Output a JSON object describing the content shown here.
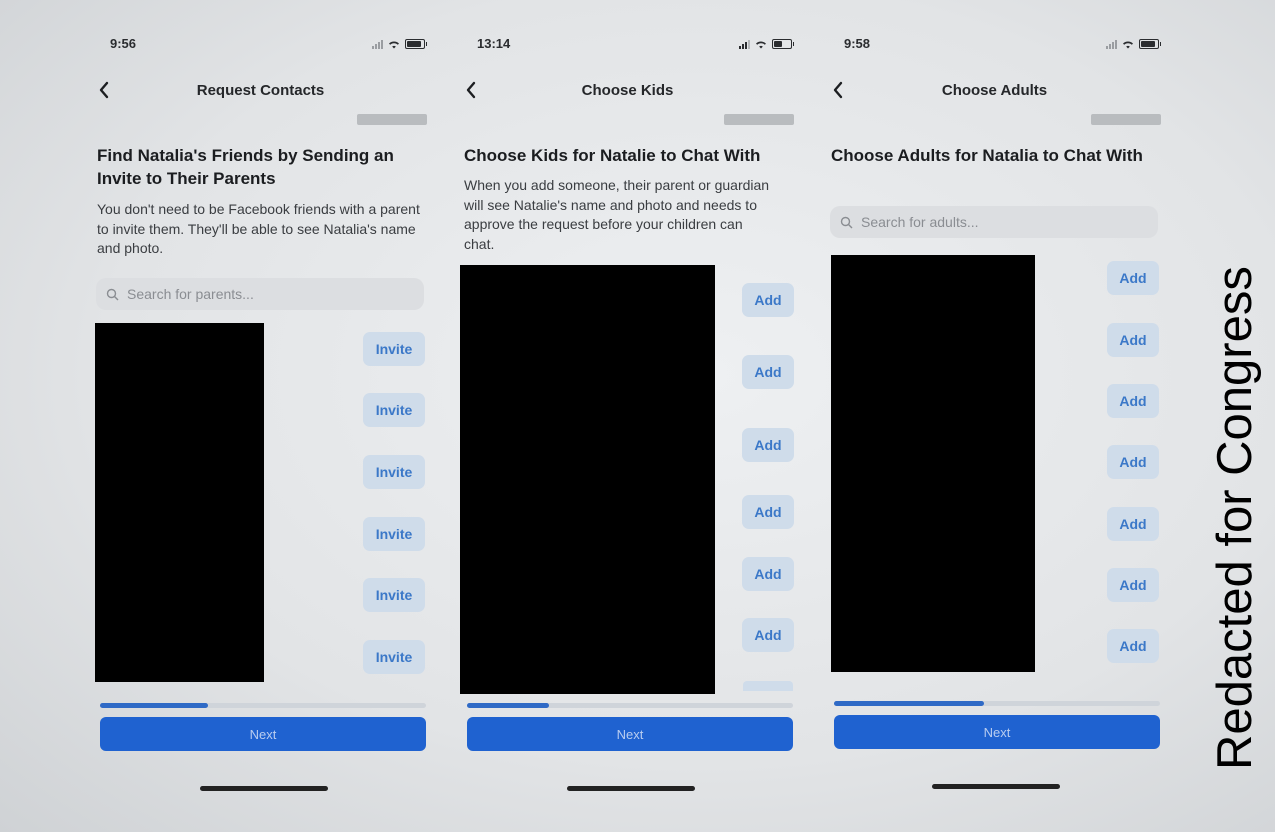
{
  "screens": [
    {
      "status_time": "9:56",
      "title": "Request Contacts",
      "heading": "Find Natalia's Friends by Sending an Invite to Their Parents",
      "description": "You don't need to be Facebook friends with a parent to invite them. They'll be able to see Natalia's name and photo.",
      "search_placeholder": "Search for parents...",
      "button_label": "Invite",
      "progress_fraction": 0.33,
      "next_label": "Next"
    },
    {
      "status_time": "13:14",
      "title": "Choose Kids",
      "heading": "Choose Kids for Natalie to Chat With",
      "description": "When you add someone, their parent or guardian will see Natalie's name and photo and needs to approve the request before your children can chat.",
      "button_label": "Add",
      "progress_fraction": 0.25,
      "next_label": "Next"
    },
    {
      "status_time": "9:58",
      "title": "Choose Adults",
      "heading": "Choose Adults for Natalia to Chat With",
      "search_placeholder": "Search for adults...",
      "button_label": "Add",
      "progress_fraction": 0.46,
      "next_label": "Next"
    }
  ],
  "watermark": "Redacted for Congress",
  "colors": {
    "accent": "#1f62d0",
    "row_button_bg": "#cfdcea",
    "row_button_text": "#3b78c8",
    "redaction": "#000000"
  },
  "icons": [
    "chevron-left-icon",
    "search-icon",
    "cellular-signal-icon",
    "wifi-icon",
    "battery-icon"
  ]
}
